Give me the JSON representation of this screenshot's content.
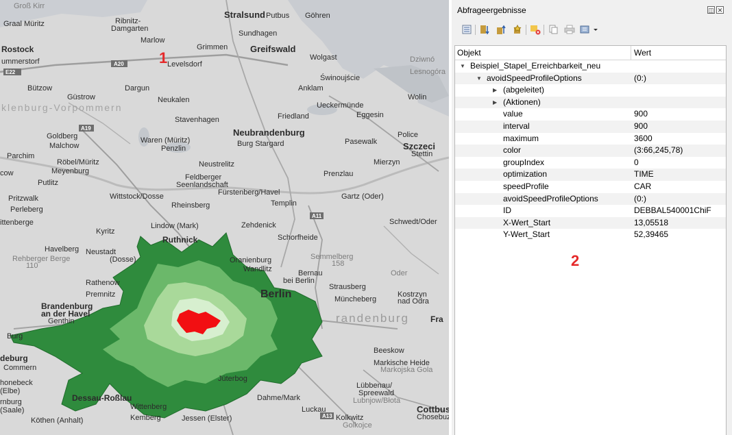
{
  "map": {
    "annotation_1": "1",
    "cities": [
      "Groß Kirr",
      "Ribnitz-Damgarten",
      "Stralsund",
      "Putbus",
      "Göhren",
      "Graal Müritz",
      "Marlow",
      "Sundhagen",
      "Rostock",
      "Grimmen",
      "Greifswald",
      "Wolgast",
      "Dziwnó",
      "ummerstorf",
      "Lesnogóra",
      "E22",
      "A20",
      "Gnoien",
      "Levelsdorf",
      "Świnoujście",
      "Bützow",
      "Dargun",
      "Anklam",
      "Güstrow",
      "Neukalen",
      "Wolin",
      "klenburg-Vorpommern",
      "Ueckermünde",
      "Friedland",
      "Eggesin",
      "Stavenhagen",
      "A19",
      "Goldberg",
      "Neubrandenburg",
      "Police",
      "Malchow",
      "Waren (Müritz)",
      "Burg Stargard",
      "Pasewalk",
      "Szczeci",
      "Penzlin",
      "Stettin",
      "Parchim",
      "Röbel/Müritz",
      "Meyenburg",
      "Neustrelitz",
      "Mierzyn",
      "Feldberger Seenlandschaft",
      "Prenzlau",
      "Putlitz",
      "Fürstenberg/Havel",
      "Wittstock/Dosse",
      "Pritzwalk",
      "Gartz (Oder)",
      "Rheinsberg",
      "Templin",
      "Perleberg",
      "A11",
      "Schwedt/Oder",
      "ittenberge",
      "Lindow (Mark)",
      "Zehdenick",
      "Kyritz",
      "Ruthnick",
      "Schorfheide",
      "Havelberg",
      "Neustadt",
      "Oranienburg",
      "Rehberger Berge",
      "(Dosse)",
      "Semmelberg",
      "110",
      "Bernau bei Berlin",
      "Rathenow",
      "Strausberg",
      "Oder",
      "Premnitz",
      "Berlin",
      "Kostrzyn nad Odra",
      "Brandenburg an der Havel",
      "Müncheberg",
      "Genthin",
      "randenburg",
      "Fra",
      "Burg",
      "Beeskow",
      "deburg",
      "Markische Heide",
      "Commern",
      "Markojska Gola",
      "Lübbenau/Spreewald",
      "honebeck (Elbe)",
      "Jüterbog",
      "Lubnjow/Błota",
      "Dessau-Roßlau",
      "Dahme/Mark",
      "rnburg (Saale)",
      "Wittenberg",
      "Luckau",
      "Cottbus",
      "Chosebuz",
      "Köthen (Anhalt)",
      "Jessen (Elster)",
      "Kolkwitz",
      "Golkojce",
      "A13",
      "Wandlitz",
      "158",
      "A9"
    ],
    "isochrone_colors": {
      "outer": "#2f8b3d",
      "ring2": "#6bb86a",
      "ring3": "#a9d99a",
      "ring4": "#d7efcf",
      "center": "#f20f12"
    }
  },
  "panel": {
    "title": "Abfrageergebnisse",
    "annotation_2": "2",
    "toolbar_icons": [
      "expand-tree-icon",
      "collapse-tree-icon",
      "expand-all-icon",
      "select-feature-icon",
      "clear-results-icon",
      "copy-icon",
      "print-icon",
      "identify-mode-icon"
    ],
    "columns": {
      "object": "Objekt",
      "value": "Wert"
    },
    "rows": [
      {
        "label": "Beispiel_Stapel_Erreichbarkeit_neu",
        "value": "",
        "level": 0,
        "expander": "▼"
      },
      {
        "label": "avoidSpeedProfileOptions",
        "value": "(0:)",
        "level": 1,
        "expander": "▼"
      },
      {
        "label": "(abgeleitet)",
        "value": "",
        "level": 2,
        "expander": "▶"
      },
      {
        "label": "(Aktionen)",
        "value": "",
        "level": 2,
        "expander": "▶"
      },
      {
        "label": "value",
        "value": "900",
        "level": 2,
        "expander": ""
      },
      {
        "label": "interval",
        "value": "900",
        "level": 2,
        "expander": ""
      },
      {
        "label": "maximum",
        "value": "3600",
        "level": 2,
        "expander": ""
      },
      {
        "label": "color",
        "value": "(3:66,245,78)",
        "level": 2,
        "expander": ""
      },
      {
        "label": "groupIndex",
        "value": "0",
        "level": 2,
        "expander": ""
      },
      {
        "label": "optimization",
        "value": "TIME",
        "level": 2,
        "expander": ""
      },
      {
        "label": "speedProfile",
        "value": "CAR",
        "level": 2,
        "expander": ""
      },
      {
        "label": "avoidSpeedProfileOptions",
        "value": "(0:)",
        "level": 2,
        "expander": ""
      },
      {
        "label": "ID",
        "value": "DEBBAL540001ChiF",
        "level": 2,
        "expander": ""
      },
      {
        "label": "X-Wert_Start",
        "value": "13,05518",
        "level": 2,
        "expander": ""
      },
      {
        "label": "Y-Wert_Start",
        "value": "52,39465",
        "level": 2,
        "expander": ""
      }
    ]
  }
}
